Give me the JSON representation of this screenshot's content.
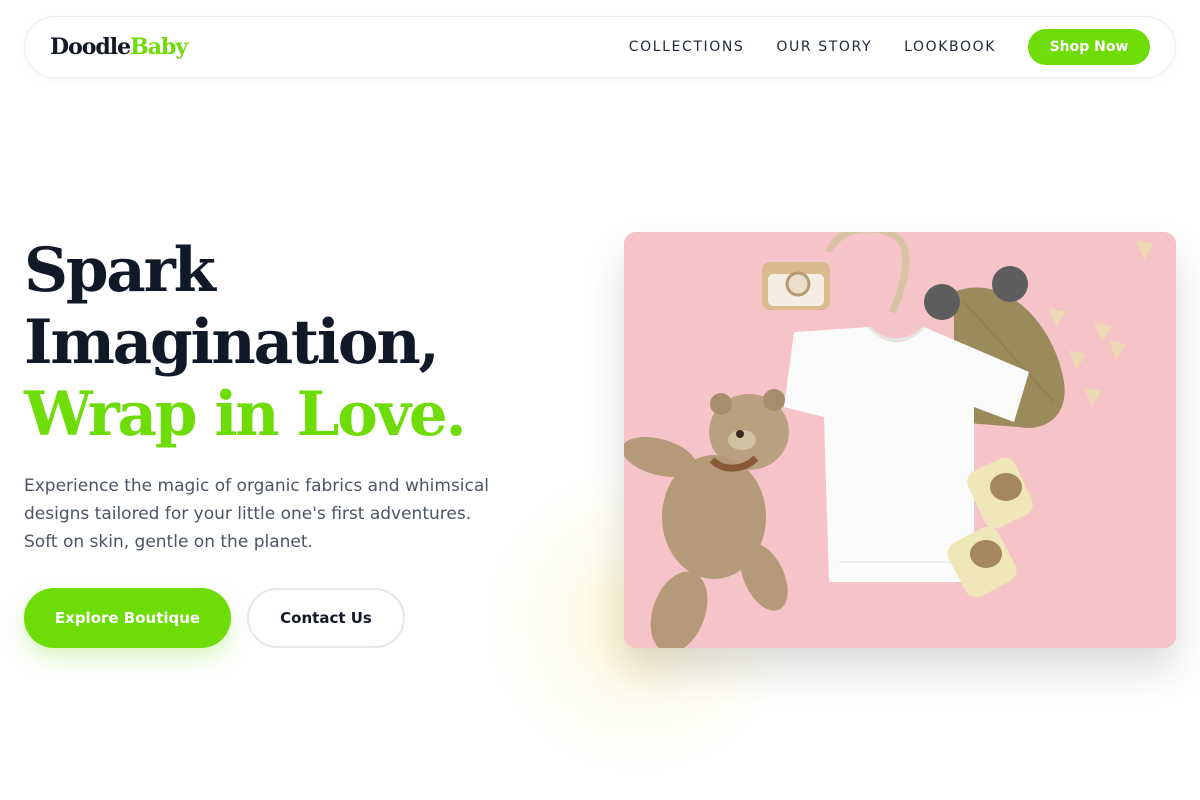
{
  "brand": {
    "logo_part1": "Doodle",
    "logo_part2": "Baby"
  },
  "nav": {
    "links": [
      "COLLECTIONS",
      "OUR STORY",
      "LOOKBOOK"
    ],
    "cta": "Shop Now"
  },
  "hero": {
    "title_line1": "Spark",
    "title_line2": "Imagination,",
    "title_line3": "Wrap in Love.",
    "description": "Experience the magic of organic fabrics and whimsical designs tailored for your little one's first adventures. Soft on skin, gentle on the planet.",
    "primary_button": "Explore Boutique",
    "secondary_button": "Contact Us"
  },
  "colors": {
    "accent": "#6ddc07",
    "heading": "#111827",
    "body_text": "#4b5563",
    "image_background": "#f6c3c8"
  }
}
